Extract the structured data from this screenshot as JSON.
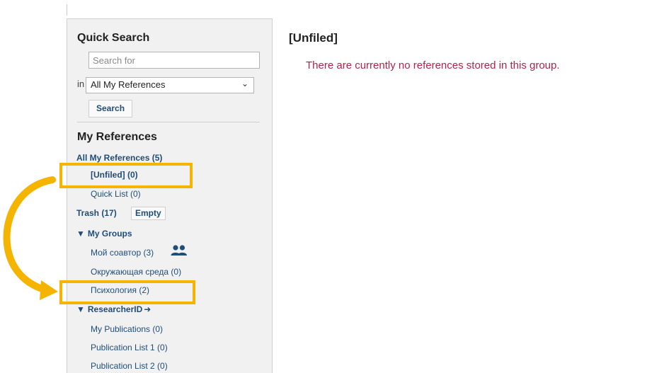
{
  "sidebar": {
    "quick_search": {
      "title": "Quick Search",
      "placeholder": "Search for",
      "in_label": "in",
      "scope_selected": "All My References",
      "search_button": "Search"
    },
    "my_references": {
      "title": "My References",
      "all_refs": "All My References (5)",
      "unfiled": "[Unfiled] (0)",
      "quick_list": "Quick List (0)",
      "trash": "Trash (17)",
      "empty_button": "Empty",
      "my_groups": "My Groups",
      "groups": [
        "Мой соавтор (3)",
        "Окружающая среда (0)",
        "Психология (2)"
      ],
      "researcher_id": "ResearcherID",
      "researcher_items": [
        "My Publications (0)",
        "Publication List 1 (0)",
        "Publication List 2 (0)"
      ]
    }
  },
  "main": {
    "title": "[Unfiled]",
    "empty_message": "There are currently no references stored in this group."
  },
  "colors": {
    "highlight": "#f5b400",
    "link": "#1f4d7a",
    "message": "#b0244a",
    "sidebar_bg": "#f1f1f1"
  }
}
